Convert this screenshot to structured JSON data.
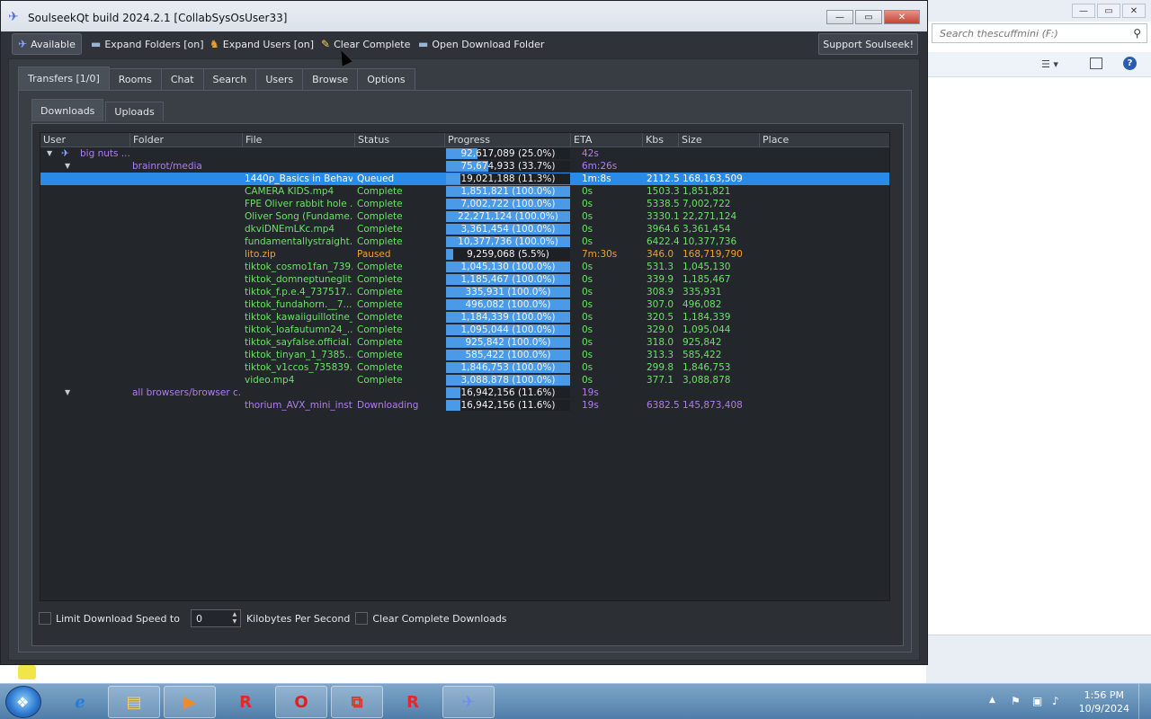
{
  "window": {
    "title": "SoulseekQt build 2024.2.1 [CollabSysOsUser33]",
    "min": "—",
    "max": "▭",
    "close": "✕"
  },
  "toolbar": {
    "available": "Available",
    "expand_folders": "Expand Folders [on]",
    "expand_users": "Expand Users [on]",
    "clear_complete": "Clear Complete",
    "open_download_folder": "Open Download Folder",
    "support": "Support Soulseek!"
  },
  "tabs": [
    "Transfers [1/0]",
    "Rooms",
    "Chat",
    "Search",
    "Users",
    "Browse",
    "Options"
  ],
  "subtabs": [
    "Downloads",
    "Uploads"
  ],
  "columns": [
    "User",
    "Folder",
    "File",
    "Status",
    "Progress",
    "ETA",
    "Kbs",
    "Size",
    "Place"
  ],
  "rows": [
    {
      "level": "user",
      "user": "big nuts ...",
      "progress": "92,617,089 (25.0%)",
      "pct": 25.0,
      "eta": "42s",
      "kind": "purple"
    },
    {
      "level": "folder",
      "folder": "brainrot/media",
      "progress": "75,674,933 (33.7%)",
      "pct": 33.7,
      "eta": "6m:26s",
      "kind": "purple"
    },
    {
      "level": "file",
      "file": "1440p_Basics in Behav...",
      "status": "Queued",
      "progress": "19,021,188 (11.3%)",
      "pct": 11.3,
      "eta": "1m:8s",
      "kbs": "2112.5",
      "size": "168,163,509",
      "kind": "white",
      "selected": true
    },
    {
      "level": "file",
      "file": "CAMERA KIDS.mp4",
      "status": "Complete",
      "progress": "1,851,821 (100.0%)",
      "pct": 100,
      "eta": "0s",
      "kbs": "1503.3",
      "size": "1,851,821",
      "kind": "green"
    },
    {
      "level": "file",
      "file": "FPE Oliver rabbit hole ...",
      "status": "Complete",
      "progress": "7,002,722 (100.0%)",
      "pct": 100,
      "eta": "0s",
      "kbs": "5338.5",
      "size": "7,002,722",
      "kind": "green"
    },
    {
      "level": "file",
      "file": "Oliver Song (Fundame...",
      "status": "Complete",
      "progress": "22,271,124 (100.0%)",
      "pct": 100,
      "eta": "0s",
      "kbs": "3330.1",
      "size": "22,271,124",
      "kind": "green"
    },
    {
      "level": "file",
      "file": "dkviDNEmLKc.mp4",
      "status": "Complete",
      "progress": "3,361,454 (100.0%)",
      "pct": 100,
      "eta": "0s",
      "kbs": "3964.6",
      "size": "3,361,454",
      "kind": "green"
    },
    {
      "level": "file",
      "file": "fundamentallystraight...",
      "status": "Complete",
      "progress": "10,377,736 (100.0%)",
      "pct": 100,
      "eta": "0s",
      "kbs": "6422.4",
      "size": "10,377,736",
      "kind": "green"
    },
    {
      "level": "file",
      "file": "lito.zip",
      "status": "Paused",
      "progress": "9,259,068 (5.5%)",
      "pct": 5.5,
      "eta": "7m:30s",
      "kbs": "346.0",
      "size": "168,719,790",
      "kind": "orange"
    },
    {
      "level": "file",
      "file": "tiktok_cosmo1fan_739...",
      "status": "Complete",
      "progress": "1,045,130 (100.0%)",
      "pct": 100,
      "eta": "0s",
      "kbs": "531.3",
      "size": "1,045,130",
      "kind": "green"
    },
    {
      "level": "file",
      "file": "tiktok_domneptuneglit...",
      "status": "Complete",
      "progress": "1,185,467 (100.0%)",
      "pct": 100,
      "eta": "0s",
      "kbs": "339.9",
      "size": "1,185,467",
      "kind": "green"
    },
    {
      "level": "file",
      "file": "tiktok_f.p.e.4_737517...",
      "status": "Complete",
      "progress": "335,931 (100.0%)",
      "pct": 100,
      "eta": "0s",
      "kbs": "308.9",
      "size": "335,931",
      "kind": "green"
    },
    {
      "level": "file",
      "file": "tiktok_fundahorn.__7...",
      "status": "Complete",
      "progress": "496,082 (100.0%)",
      "pct": 100,
      "eta": "0s",
      "kbs": "307.0",
      "size": "496,082",
      "kind": "green"
    },
    {
      "level": "file",
      "file": "tiktok_kawaiiguillotine_...",
      "status": "Complete",
      "progress": "1,184,339 (100.0%)",
      "pct": 100,
      "eta": "0s",
      "kbs": "320.5",
      "size": "1,184,339",
      "kind": "green"
    },
    {
      "level": "file",
      "file": "tiktok_loafautumn24_...",
      "status": "Complete",
      "progress": "1,095,044 (100.0%)",
      "pct": 100,
      "eta": "0s",
      "kbs": "329.0",
      "size": "1,095,044",
      "kind": "green"
    },
    {
      "level": "file",
      "file": "tiktok_sayfalse.official...",
      "status": "Complete",
      "progress": "925,842 (100.0%)",
      "pct": 100,
      "eta": "0s",
      "kbs": "318.0",
      "size": "925,842",
      "kind": "green"
    },
    {
      "level": "file",
      "file": "tiktok_tinyan_1_7385...",
      "status": "Complete",
      "progress": "585,422 (100.0%)",
      "pct": 100,
      "eta": "0s",
      "kbs": "313.3",
      "size": "585,422",
      "kind": "green"
    },
    {
      "level": "file",
      "file": "tiktok_v1ccos_735839...",
      "status": "Complete",
      "progress": "1,846,753 (100.0%)",
      "pct": 100,
      "eta": "0s",
      "kbs": "299.8",
      "size": "1,846,753",
      "kind": "green"
    },
    {
      "level": "file",
      "file": "video.mp4",
      "status": "Complete",
      "progress": "3,088,878 (100.0%)",
      "pct": 100,
      "eta": "0s",
      "kbs": "377.1",
      "size": "3,088,878",
      "kind": "green"
    },
    {
      "level": "folder",
      "folder": "all browsers/browser c...",
      "progress": "16,942,156 (11.6%)",
      "pct": 11.6,
      "eta": "19s",
      "kind": "purple"
    },
    {
      "level": "file",
      "file": "thorium_AVX_mini_inst...",
      "status": "Downloading",
      "progress": "16,942,156 (11.6%)",
      "pct": 11.6,
      "eta": "19s",
      "kbs": "6382.5",
      "size": "145,873,408",
      "kind": "purple"
    }
  ],
  "bottom": {
    "limit_label": "Limit Download Speed to",
    "limit_value": "0",
    "unit_label": "Kilobytes Per Second",
    "clear_label": "Clear Complete Downloads"
  },
  "explorer": {
    "search_placeholder": "Search thescuffmini (F:)"
  },
  "taskbar": {
    "time": "1:56 PM",
    "date": "10/9/2024"
  },
  "colors": {
    "selected_row": "#2a8ae8",
    "complete": "#6ee06a",
    "paused": "#f0a030",
    "folder": "#b27cf0",
    "progress_fill": "#4a9ae8"
  }
}
